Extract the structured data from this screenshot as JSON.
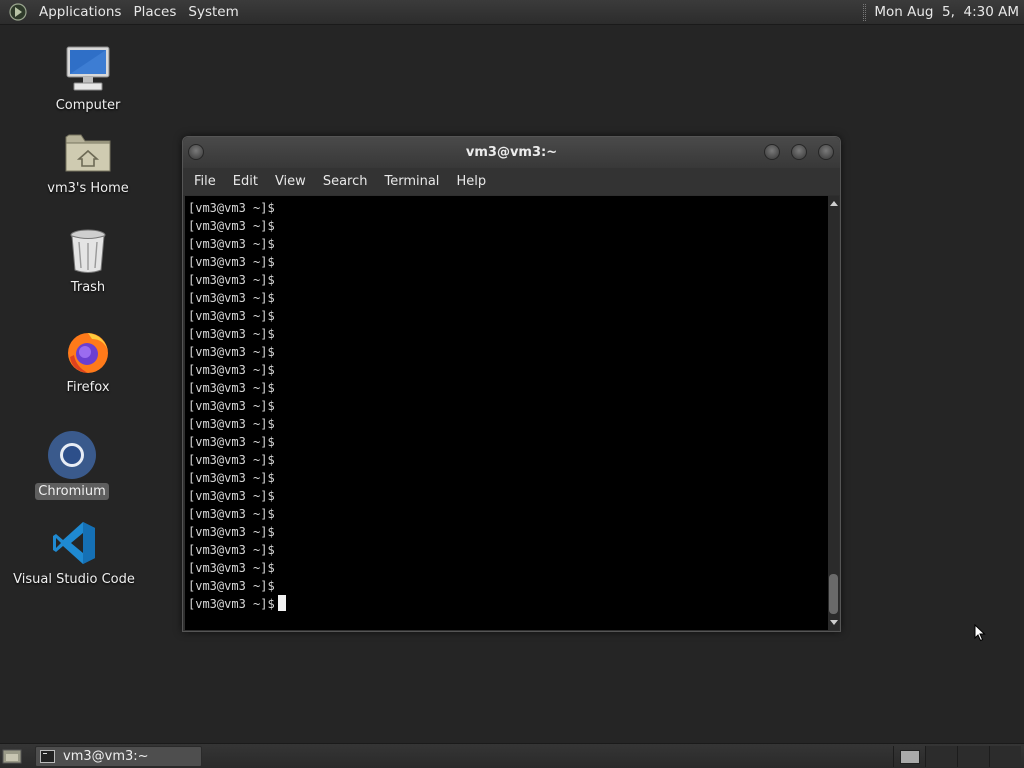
{
  "top_panel": {
    "menus": [
      "Applications",
      "Places",
      "System"
    ],
    "clock": "Mon Aug  5,  4:30 AM"
  },
  "desktop_icons": [
    {
      "label": "Computer",
      "icon": "computer-icon"
    },
    {
      "label": "vm3's Home",
      "icon": "home-folder-icon"
    },
    {
      "label": "Trash",
      "icon": "trash-icon"
    },
    {
      "label": "Firefox",
      "icon": "firefox-icon"
    },
    {
      "label": "Chromium",
      "icon": "chromium-icon",
      "selected": true
    },
    {
      "label": "Visual Studio Code",
      "icon": "vscode-icon"
    }
  ],
  "terminal": {
    "title": "vm3@vm3:~",
    "menu": [
      "File",
      "Edit",
      "View",
      "Search",
      "Terminal",
      "Help"
    ],
    "prompt": "[vm3@vm3 ~]$",
    "lines": [
      "[vm3@vm3 ~]$",
      "[vm3@vm3 ~]$",
      "[vm3@vm3 ~]$",
      "[vm3@vm3 ~]$",
      "[vm3@vm3 ~]$",
      "[vm3@vm3 ~]$",
      "[vm3@vm3 ~]$",
      "[vm3@vm3 ~]$",
      "[vm3@vm3 ~]$",
      "[vm3@vm3 ~]$",
      "[vm3@vm3 ~]$",
      "[vm3@vm3 ~]$",
      "[vm3@vm3 ~]$",
      "[vm3@vm3 ~]$",
      "[vm3@vm3 ~]$",
      "[vm3@vm3 ~]$",
      "[vm3@vm3 ~]$",
      "[vm3@vm3 ~]$",
      "[vm3@vm3 ~]$",
      "[vm3@vm3 ~]$",
      "[vm3@vm3 ~]$",
      "[vm3@vm3 ~]$",
      "[vm3@vm3 ~]$"
    ]
  },
  "taskbar": {
    "window_button": "vm3@vm3:~"
  },
  "colors": {
    "desktop_bg": "#252525",
    "terminal_bg": "#000000",
    "terminal_fg": "#d8d8d8"
  }
}
